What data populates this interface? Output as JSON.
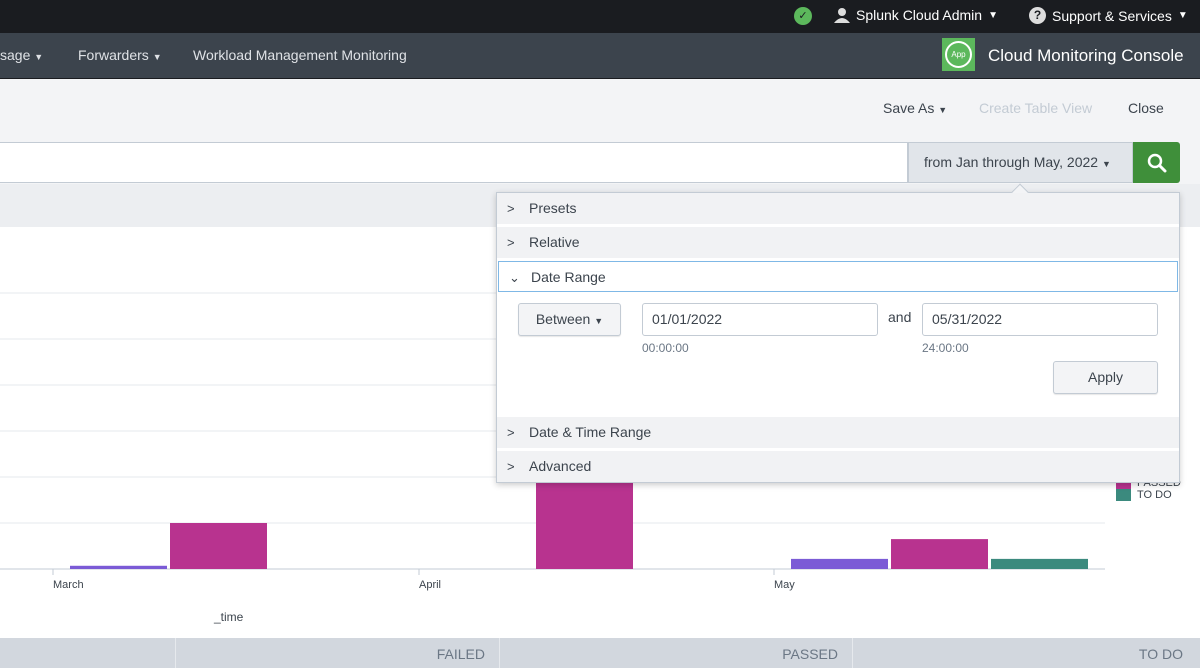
{
  "topbar": {
    "status_icon": "check-circle-icon",
    "user": "Splunk Cloud Admin",
    "support": "Support & Services"
  },
  "appbar": {
    "nav": [
      "sage",
      "Forwarders",
      "Workload Management Monitoring"
    ],
    "logo_text": "App",
    "title": "Cloud Monitoring Console"
  },
  "header": {
    "save_as": "Save As",
    "create_table_view": "Create Table View",
    "close": "Close"
  },
  "search": {
    "query": "",
    "time_range": "from Jan through May, 2022"
  },
  "time_picker": {
    "sections": [
      "Presets",
      "Relative",
      "Date Range",
      "Date & Time Range",
      "Advanced"
    ],
    "open_section": "Date Range",
    "mode": "Between",
    "start_date": "01/01/2022",
    "start_time": "00:00:00",
    "and_label": "and",
    "end_date": "05/31/2022",
    "end_time": "24:00:00",
    "apply": "Apply"
  },
  "chart_data": {
    "type": "bar",
    "xlabel": "_time",
    "ylabel": "",
    "categories": [
      "March",
      "April",
      "May"
    ],
    "grid": true,
    "legend": "right",
    "series": [
      {
        "name": "FAILED",
        "color": "#7b5bd6",
        "values": [
          0.07,
          0,
          0.22
        ]
      },
      {
        "name": "PASSED",
        "color": "#b8338f",
        "values": [
          1.0,
          2.5,
          0.65
        ]
      },
      {
        "name": "TO DO",
        "color": "#3b8a7e",
        "values": [
          0,
          0,
          0.22
        ]
      }
    ],
    "legend_visible": [
      "PASSED",
      "TO DO"
    ]
  },
  "table": {
    "columns": [
      "",
      "FAILED",
      "PASSED",
      "TO DO"
    ]
  }
}
